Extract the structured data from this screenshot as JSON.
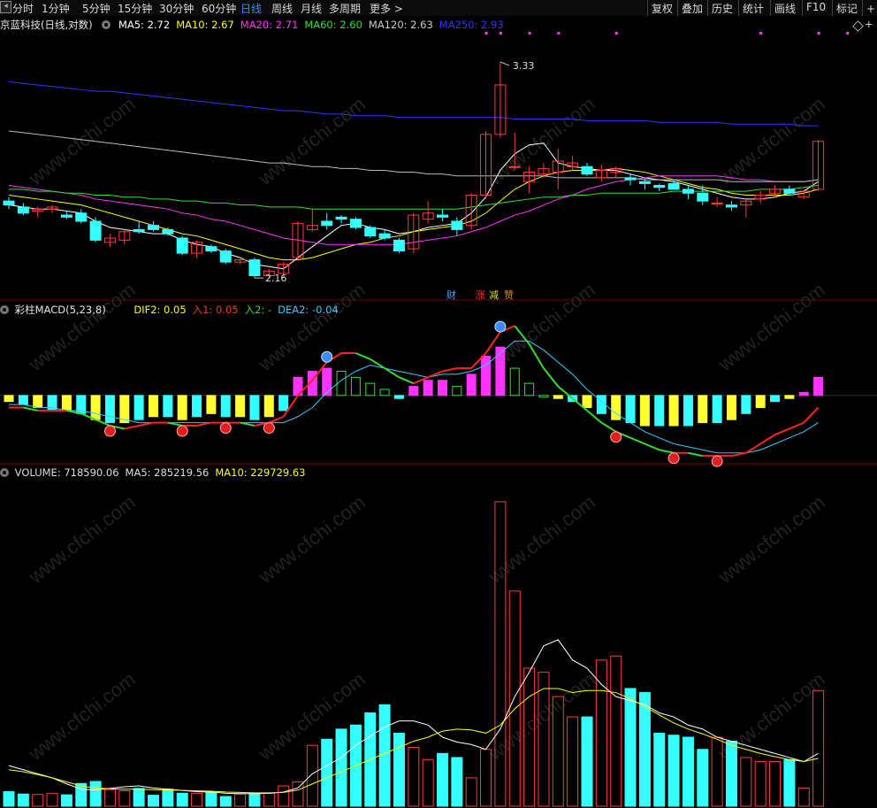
{
  "toolbar": {
    "timeframes": [
      "分时",
      "1分钟",
      "5分钟",
      "15分钟",
      "30分钟",
      "60分钟",
      "日线",
      "周线",
      "月线",
      "多周期",
      "更多 >"
    ],
    "active_timeframe": "日线",
    "right_buttons": [
      "复权",
      "叠加",
      "历史",
      "统计",
      "画线",
      "F10",
      "标记",
      "+自"
    ]
  },
  "price_panel": {
    "stock_title": "京蓝科技(日线,对数)",
    "ma_legend": [
      {
        "label": "MA5: 2.72",
        "color": "#ffffff"
      },
      {
        "label": "MA10: 2.67",
        "color": "#ffff00"
      },
      {
        "label": "MA20: 2.71",
        "color": "#ff33ff"
      },
      {
        "label": "MA60: 2.60",
        "color": "#33dd33"
      },
      {
        "label": "MA120: 2.63",
        "color": "#cccccc"
      },
      {
        "label": "MA250: 2.93",
        "color": "#3333ff"
      }
    ],
    "high_label": "3.33",
    "low_label": "2.16",
    "event_tags": [
      {
        "text": "财",
        "color": "#4aa8ff"
      },
      {
        "text": "涨",
        "color": "#ff3333"
      },
      {
        "text": "减",
        "color": "#dddd33"
      },
      {
        "text": "赞",
        "color": "#dd8833"
      }
    ]
  },
  "macd_panel": {
    "title": "彩柱MACD(5,23,8)",
    "legend": [
      {
        "label": "DIF2: 0.05",
        "color": "#ffff00"
      },
      {
        "label": "入1: 0.05",
        "color": "#ff3333"
      },
      {
        "label": "入2: -",
        "color": "#33dd33"
      },
      {
        "label": "DEA2: -0.04",
        "color": "#33ccff"
      }
    ]
  },
  "volume_panel": {
    "legend": [
      {
        "label": "VOLUME: 718590.06",
        "color": "#dddddd"
      },
      {
        "label": "MA5: 285219.56",
        "color": "#dddddd"
      },
      {
        "label": "MA10: 229729.63",
        "color": "#ffff00"
      }
    ]
  },
  "watermark": "www.cfchi.com",
  "chart_data": {
    "type": "candlestick",
    "scale": "log",
    "price_ylim": [
      2.1,
      3.45
    ],
    "candles": [
      {
        "o": 2.52,
        "h": 2.54,
        "l": 2.48,
        "c": 2.5
      },
      {
        "o": 2.49,
        "h": 2.51,
        "l": 2.45,
        "c": 2.46
      },
      {
        "o": 2.47,
        "h": 2.49,
        "l": 2.44,
        "c": 2.48
      },
      {
        "o": 2.48,
        "h": 2.5,
        "l": 2.46,
        "c": 2.49
      },
      {
        "o": 2.45,
        "h": 2.47,
        "l": 2.43,
        "c": 2.44
      },
      {
        "o": 2.46,
        "h": 2.48,
        "l": 2.41,
        "c": 2.42
      },
      {
        "o": 2.42,
        "h": 2.44,
        "l": 2.32,
        "c": 2.33
      },
      {
        "o": 2.32,
        "h": 2.36,
        "l": 2.3,
        "c": 2.34
      },
      {
        "o": 2.33,
        "h": 2.38,
        "l": 2.31,
        "c": 2.37
      },
      {
        "o": 2.38,
        "h": 2.42,
        "l": 2.36,
        "c": 2.37
      },
      {
        "o": 2.4,
        "h": 2.42,
        "l": 2.37,
        "c": 2.38
      },
      {
        "o": 2.38,
        "h": 2.39,
        "l": 2.35,
        "c": 2.36
      },
      {
        "o": 2.34,
        "h": 2.35,
        "l": 2.26,
        "c": 2.27
      },
      {
        "o": 2.27,
        "h": 2.33,
        "l": 2.25,
        "c": 2.32
      },
      {
        "o": 2.3,
        "h": 2.31,
        "l": 2.27,
        "c": 2.28
      },
      {
        "o": 2.28,
        "h": 2.29,
        "l": 2.22,
        "c": 2.23
      },
      {
        "o": 2.23,
        "h": 2.25,
        "l": 2.22,
        "c": 2.24
      },
      {
        "o": 2.24,
        "h": 2.25,
        "l": 2.16,
        "c": 2.17
      },
      {
        "o": 2.17,
        "h": 2.2,
        "l": 2.16,
        "c": 2.19
      },
      {
        "o": 2.18,
        "h": 2.23,
        "l": 2.16,
        "c": 2.22
      },
      {
        "o": 2.25,
        "h": 2.42,
        "l": 2.24,
        "c": 2.41
      },
      {
        "o": 2.38,
        "h": 2.48,
        "l": 2.37,
        "c": 2.4
      },
      {
        "o": 2.42,
        "h": 2.46,
        "l": 2.38,
        "c": 2.4
      },
      {
        "o": 2.44,
        "h": 2.45,
        "l": 2.41,
        "c": 2.43
      },
      {
        "o": 2.43,
        "h": 2.44,
        "l": 2.38,
        "c": 2.39
      },
      {
        "o": 2.39,
        "h": 2.4,
        "l": 2.34,
        "c": 2.35
      },
      {
        "o": 2.36,
        "h": 2.38,
        "l": 2.33,
        "c": 2.34
      },
      {
        "o": 2.33,
        "h": 2.34,
        "l": 2.27,
        "c": 2.28
      },
      {
        "o": 2.29,
        "h": 2.46,
        "l": 2.27,
        "c": 2.45
      },
      {
        "o": 2.43,
        "h": 2.52,
        "l": 2.41,
        "c": 2.46
      },
      {
        "o": 2.45,
        "h": 2.48,
        "l": 2.42,
        "c": 2.44
      },
      {
        "o": 2.42,
        "h": 2.44,
        "l": 2.35,
        "c": 2.38
      },
      {
        "o": 2.4,
        "h": 2.56,
        "l": 2.38,
        "c": 2.55
      },
      {
        "o": 2.55,
        "h": 2.9,
        "l": 2.53,
        "c": 2.88
      },
      {
        "o": 2.88,
        "h": 3.33,
        "l": 2.86,
        "c": 3.18
      },
      {
        "o": 2.7,
        "h": 2.89,
        "l": 2.68,
        "c": 2.7
      },
      {
        "o": 2.62,
        "h": 2.7,
        "l": 2.56,
        "c": 2.67
      },
      {
        "o": 2.66,
        "h": 2.72,
        "l": 2.64,
        "c": 2.69
      },
      {
        "o": 2.67,
        "h": 2.8,
        "l": 2.58,
        "c": 2.73
      },
      {
        "o": 2.7,
        "h": 2.76,
        "l": 2.68,
        "c": 2.72
      },
      {
        "o": 2.7,
        "h": 2.72,
        "l": 2.65,
        "c": 2.66
      },
      {
        "o": 2.64,
        "h": 2.71,
        "l": 2.62,
        "c": 2.68
      },
      {
        "o": 2.67,
        "h": 2.7,
        "l": 2.64,
        "c": 2.69
      },
      {
        "o": 2.64,
        "h": 2.66,
        "l": 2.6,
        "c": 2.63
      },
      {
        "o": 2.62,
        "h": 2.64,
        "l": 2.58,
        "c": 2.61
      },
      {
        "o": 2.6,
        "h": 2.61,
        "l": 2.57,
        "c": 2.59
      },
      {
        "o": 2.61,
        "h": 2.63,
        "l": 2.59,
        "c": 2.58
      },
      {
        "o": 2.58,
        "h": 2.6,
        "l": 2.53,
        "c": 2.56
      },
      {
        "o": 2.56,
        "h": 2.6,
        "l": 2.5,
        "c": 2.52
      },
      {
        "o": 2.51,
        "h": 2.54,
        "l": 2.49,
        "c": 2.51
      },
      {
        "o": 2.5,
        "h": 2.52,
        "l": 2.47,
        "c": 2.49
      },
      {
        "o": 2.5,
        "h": 2.53,
        "l": 2.44,
        "c": 2.52
      },
      {
        "o": 2.53,
        "h": 2.57,
        "l": 2.51,
        "c": 2.55
      },
      {
        "o": 2.56,
        "h": 2.6,
        "l": 2.54,
        "c": 2.58
      },
      {
        "o": 2.58,
        "h": 2.6,
        "l": 2.55,
        "c": 2.56
      },
      {
        "o": 2.54,
        "h": 2.58,
        "l": 2.53,
        "c": 2.57
      },
      {
        "o": 2.58,
        "h": 2.85,
        "l": 2.57,
        "c": 2.84
      }
    ],
    "ma": {
      "MA5": [
        2.5,
        2.49,
        2.48,
        2.48,
        2.47,
        2.46,
        2.42,
        2.39,
        2.38,
        2.37,
        2.36,
        2.36,
        2.33,
        2.31,
        2.3,
        2.27,
        2.25,
        2.22,
        2.21,
        2.2,
        2.25,
        2.3,
        2.35,
        2.4,
        2.41,
        2.39,
        2.38,
        2.36,
        2.37,
        2.39,
        2.4,
        2.41,
        2.46,
        2.54,
        2.68,
        2.77,
        2.82,
        2.83,
        2.72,
        2.7,
        2.69,
        2.68,
        2.68,
        2.66,
        2.64,
        2.63,
        2.62,
        2.6,
        2.58,
        2.56,
        2.54,
        2.53,
        2.53,
        2.54,
        2.56,
        2.57,
        2.62
      ],
      "MA10": [
        2.55,
        2.54,
        2.53,
        2.52,
        2.51,
        2.5,
        2.48,
        2.46,
        2.44,
        2.42,
        2.4,
        2.38,
        2.36,
        2.35,
        2.33,
        2.31,
        2.29,
        2.27,
        2.25,
        2.24,
        2.24,
        2.25,
        2.27,
        2.29,
        2.31,
        2.32,
        2.34,
        2.35,
        2.37,
        2.38,
        2.39,
        2.4,
        2.42,
        2.46,
        2.52,
        2.58,
        2.62,
        2.65,
        2.67,
        2.68,
        2.68,
        2.68,
        2.69,
        2.68,
        2.67,
        2.65,
        2.63,
        2.61,
        2.59,
        2.58,
        2.56,
        2.55,
        2.55,
        2.55,
        2.55,
        2.56,
        2.58
      ],
      "MA20": [
        2.6,
        2.59,
        2.58,
        2.57,
        2.56,
        2.55,
        2.53,
        2.52,
        2.51,
        2.5,
        2.49,
        2.48,
        2.46,
        2.45,
        2.43,
        2.42,
        2.4,
        2.38,
        2.36,
        2.34,
        2.33,
        2.32,
        2.31,
        2.31,
        2.31,
        2.31,
        2.31,
        2.31,
        2.32,
        2.33,
        2.34,
        2.35,
        2.37,
        2.39,
        2.42,
        2.45,
        2.47,
        2.5,
        2.53,
        2.55,
        2.58,
        2.6,
        2.62,
        2.63,
        2.64,
        2.65,
        2.65,
        2.65,
        2.65,
        2.65,
        2.64,
        2.63,
        2.63,
        2.62,
        2.62,
        2.62,
        2.63
      ],
      "MA60": [
        2.58,
        2.58,
        2.57,
        2.57,
        2.56,
        2.56,
        2.55,
        2.55,
        2.54,
        2.54,
        2.53,
        2.53,
        2.52,
        2.52,
        2.51,
        2.51,
        2.5,
        2.5,
        2.49,
        2.49,
        2.49,
        2.48,
        2.48,
        2.48,
        2.48,
        2.48,
        2.48,
        2.48,
        2.48,
        2.48,
        2.48,
        2.48,
        2.49,
        2.5,
        2.51,
        2.52,
        2.53,
        2.54,
        2.54,
        2.55,
        2.55,
        2.56,
        2.56,
        2.56,
        2.56,
        2.56,
        2.57,
        2.57,
        2.57,
        2.57,
        2.57,
        2.57,
        2.58,
        2.58,
        2.58,
        2.59,
        2.6
      ],
      "MA120": [
        2.9,
        2.89,
        2.88,
        2.87,
        2.86,
        2.85,
        2.84,
        2.83,
        2.82,
        2.81,
        2.8,
        2.79,
        2.78,
        2.77,
        2.76,
        2.75,
        2.74,
        2.73,
        2.72,
        2.72,
        2.71,
        2.7,
        2.7,
        2.69,
        2.69,
        2.68,
        2.68,
        2.67,
        2.67,
        2.66,
        2.66,
        2.65,
        2.65,
        2.65,
        2.65,
        2.65,
        2.65,
        2.65,
        2.64,
        2.64,
        2.64,
        2.64,
        2.64,
        2.64,
        2.63,
        2.63,
        2.63,
        2.63,
        2.63,
        2.63,
        2.62,
        2.62,
        2.62,
        2.62,
        2.62,
        2.62,
        2.63
      ],
      "MA250": [
        3.2,
        3.19,
        3.18,
        3.17,
        3.16,
        3.15,
        3.14,
        3.14,
        3.13,
        3.12,
        3.11,
        3.1,
        3.09,
        3.08,
        3.07,
        3.06,
        3.05,
        3.04,
        3.03,
        3.02,
        3.02,
        3.01,
        3.0,
        3.0,
        2.99,
        2.99,
        2.99,
        2.98,
        2.98,
        2.98,
        2.98,
        2.98,
        2.98,
        2.98,
        2.98,
        2.97,
        2.97,
        2.97,
        2.97,
        2.97,
        2.96,
        2.96,
        2.96,
        2.96,
        2.96,
        2.95,
        2.95,
        2.95,
        2.95,
        2.95,
        2.94,
        2.94,
        2.94,
        2.94,
        2.94,
        2.93,
        2.93
      ]
    },
    "macd": {
      "ylim": [
        -0.22,
        0.26
      ],
      "hist": [
        -0.02,
        -0.03,
        -0.04,
        -0.05,
        -0.05,
        -0.06,
        -0.08,
        -0.09,
        -0.09,
        -0.08,
        -0.07,
        -0.07,
        -0.08,
        -0.07,
        -0.06,
        -0.07,
        -0.07,
        -0.08,
        -0.07,
        -0.05,
        0.06,
        0.08,
        0.09,
        0.08,
        0.06,
        0.04,
        0.02,
        -0.01,
        0.03,
        0.05,
        0.05,
        0.03,
        0.07,
        0.13,
        0.16,
        0.09,
        0.04,
        0.0,
        -0.01,
        -0.02,
        -0.04,
        -0.06,
        -0.08,
        -0.09,
        -0.1,
        -0.1,
        -0.1,
        -0.1,
        -0.09,
        -0.09,
        -0.08,
        -0.06,
        -0.04,
        -0.02,
        -0.01,
        0.01,
        0.06
      ],
      "dif": [
        -0.04,
        -0.04,
        -0.05,
        -0.05,
        -0.05,
        -0.06,
        -0.08,
        -0.1,
        -0.11,
        -0.1,
        -0.09,
        -0.09,
        -0.1,
        -0.1,
        -0.09,
        -0.09,
        -0.09,
        -0.1,
        -0.09,
        -0.07,
        0.0,
        0.05,
        0.11,
        0.14,
        0.14,
        0.12,
        0.09,
        0.06,
        0.04,
        0.06,
        0.08,
        0.09,
        0.09,
        0.14,
        0.21,
        0.23,
        0.17,
        0.09,
        0.03,
        -0.01,
        -0.05,
        -0.09,
        -0.12,
        -0.14,
        -0.16,
        -0.18,
        -0.19,
        -0.19,
        -0.2,
        -0.2,
        -0.2,
        -0.19,
        -0.16,
        -0.13,
        -0.11,
        -0.09,
        -0.04
      ],
      "dea": [
        -0.03,
        -0.03,
        -0.04,
        -0.04,
        -0.05,
        -0.05,
        -0.06,
        -0.07,
        -0.08,
        -0.09,
        -0.09,
        -0.09,
        -0.09,
        -0.09,
        -0.09,
        -0.09,
        -0.09,
        -0.09,
        -0.09,
        -0.09,
        -0.07,
        -0.04,
        0.01,
        0.05,
        0.08,
        0.1,
        0.09,
        0.08,
        0.07,
        0.06,
        0.07,
        0.07,
        0.08,
        0.1,
        0.14,
        0.18,
        0.18,
        0.15,
        0.11,
        0.07,
        0.02,
        -0.02,
        -0.06,
        -0.09,
        -0.12,
        -0.14,
        -0.16,
        -0.17,
        -0.18,
        -0.19,
        -0.19,
        -0.19,
        -0.18,
        -0.16,
        -0.14,
        -0.12,
        -0.09
      ],
      "buy_markers": [
        7,
        12,
        15,
        18,
        42,
        46,
        49
      ],
      "sell_markers": [
        22,
        34
      ]
    },
    "volume": {
      "ylim": [
        0,
        800000
      ],
      "values": [
        36000,
        30000,
        29000,
        32000,
        28000,
        56000,
        61000,
        41000,
        38000,
        44000,
        27000,
        42000,
        32000,
        32000,
        34000,
        24000,
        30000,
        31000,
        32000,
        50000,
        60000,
        150000,
        165000,
        190000,
        200000,
        230000,
        250000,
        180000,
        145000,
        115000,
        130000,
        120000,
        70000,
        140000,
        750000,
        530000,
        340000,
        330000,
        270000,
        220000,
        220000,
        360000,
        370000,
        290000,
        280000,
        180000,
        175000,
        170000,
        140000,
        170000,
        160000,
        120000,
        110000,
        110000,
        115000,
        45000,
        285000
      ],
      "ma5": [
        100000,
        90000,
        80000,
        70000,
        55000,
        42000,
        40000,
        44000,
        48000,
        50000,
        45000,
        42000,
        39000,
        36000,
        35000,
        32000,
        31000,
        31000,
        32000,
        35000,
        45000,
        80000,
        100000,
        120000,
        150000,
        172000,
        195000,
        210000,
        210000,
        200000,
        170000,
        158000,
        152000,
        140000,
        190000,
        270000,
        330000,
        395000,
        410000,
        360000,
        340000,
        300000,
        270000,
        260000,
        250000,
        230000,
        220000,
        200000,
        190000,
        170000,
        160000,
        150000,
        140000,
        130000,
        120000,
        110000,
        130000
      ],
      "ma10": [
        90000,
        85000,
        78000,
        70000,
        60000,
        50000,
        45000,
        43000,
        42000,
        42000,
        41000,
        40000,
        39000,
        38000,
        37000,
        35000,
        34000,
        33000,
        33000,
        34000,
        40000,
        55000,
        70000,
        85000,
        100000,
        115000,
        130000,
        145000,
        160000,
        170000,
        185000,
        190000,
        188000,
        180000,
        200000,
        240000,
        270000,
        290000,
        290000,
        280000,
        285000,
        285000,
        280000,
        265000,
        245000,
        225000,
        205000,
        190000,
        178000,
        165000,
        150000,
        140000,
        130000,
        122000,
        115000,
        110000,
        118000
      ]
    }
  }
}
